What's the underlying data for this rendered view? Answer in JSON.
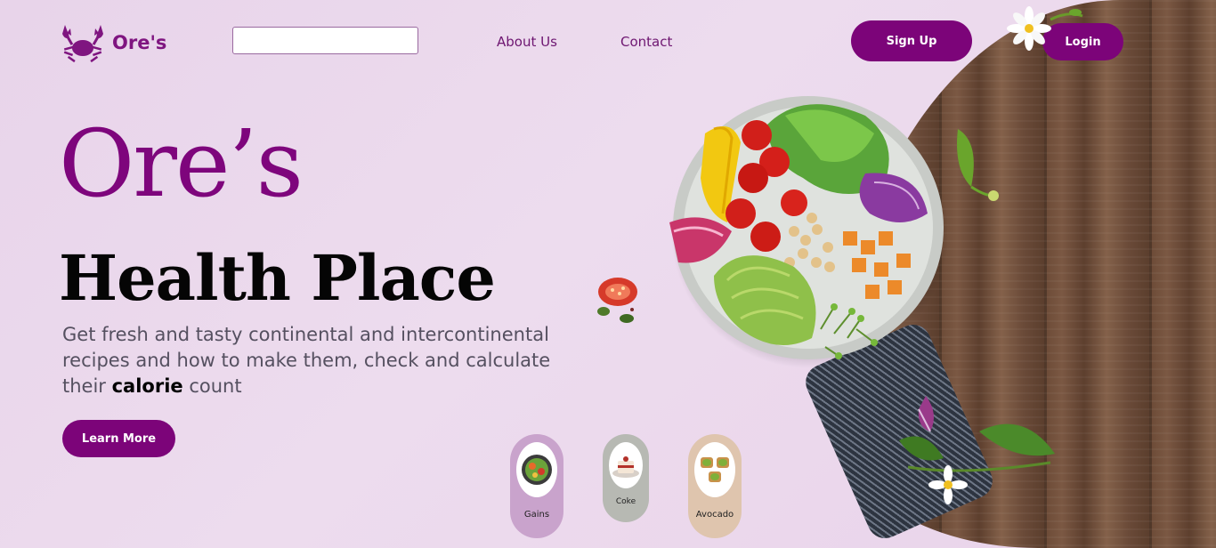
{
  "brand": {
    "name": "Ore's"
  },
  "header": {
    "search": {
      "value": "",
      "placeholder": ""
    },
    "nav": {
      "about": "About Us",
      "contact": "Contact"
    },
    "signup_label": "Sign Up",
    "login_label": "Login"
  },
  "hero": {
    "brand_title": "Ore’s",
    "title": "Health Place",
    "desc_before": "Get fresh and tasty continental and intercontinental recipes and how to make them, check and calculate their ",
    "desc_bold": "calorie",
    "desc_after": " count",
    "cta_label": "Learn More"
  },
  "categories": [
    {
      "label": "Gains",
      "color": "#c9a3cc"
    },
    {
      "label": "Coke",
      "color": "#b7b9b3"
    },
    {
      "label": "Avocado",
      "color": "#dfc5ae"
    }
  ],
  "colors": {
    "accent": "#7c0479",
    "background": "#ecd8ec"
  }
}
